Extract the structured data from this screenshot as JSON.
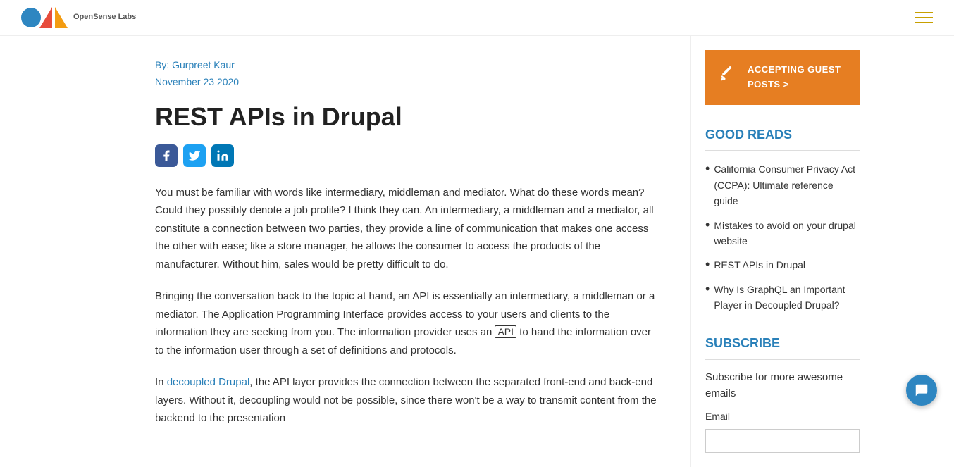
{
  "header": {
    "logo_name": "OpenSense Labs",
    "logo_subtext": "OpenSense Labs",
    "menu_icon_label": "menu"
  },
  "article": {
    "author_prefix": "By:",
    "author_name": "Gurpreet Kaur",
    "date": "November 23 2020",
    "title": "REST APIs in Drupal",
    "social": [
      {
        "name": "facebook",
        "icon": "fb"
      },
      {
        "name": "twitter",
        "icon": "tw"
      },
      {
        "name": "linkedin",
        "icon": "li"
      }
    ],
    "body": [
      "You must be familiar with words like intermediary, middleman and mediator. What do these words mean? Could they possibly denote a job profile? I think they can. An intermediary, a middleman and a mediator, all constitute a connection between two parties, they provide a line of communication that makes one access the other with ease; like a store manager, he allows the consumer to access the products of the manufacturer. Without him, sales would be pretty difficult to do.",
      "Bringing the conversation back to the topic at hand, an API is essentially an intermediary, a middleman or a mediator. The Application Programming Interface provides access to your users and clients to the information they are seeking from you. The information provider uses an [API] to hand the information over to the information user through a set of definitions and protocols.",
      "In decoupled Drupal, the API layer provides the connection between the separated front-end and back-end layers. Without it, decoupling would not be possible, since there won't be a way to transmit content from the backend to the presentation"
    ],
    "decoupled_link_text": "decoupled Drupal"
  },
  "sidebar": {
    "guest_post_btn_label": "ACCEPTING GUEST POSTS >",
    "good_reads_title": "GOOD READS",
    "good_reads": [
      {
        "text": "California Consumer Privacy Act (CCPA): Ultimate reference guide",
        "href": "#"
      },
      {
        "text": "Mistakes to avoid on your drupal website",
        "href": "#"
      },
      {
        "text": "REST APIs in Drupal",
        "href": "#"
      },
      {
        "text": "Why Is GraphQL an Important Player in Decoupled Drupal?",
        "href": "#"
      }
    ],
    "subscribe_title": "SUBSCRIBE",
    "subscribe_text": "Subscribe for more awesome emails",
    "email_label": "Email",
    "email_placeholder": ""
  }
}
